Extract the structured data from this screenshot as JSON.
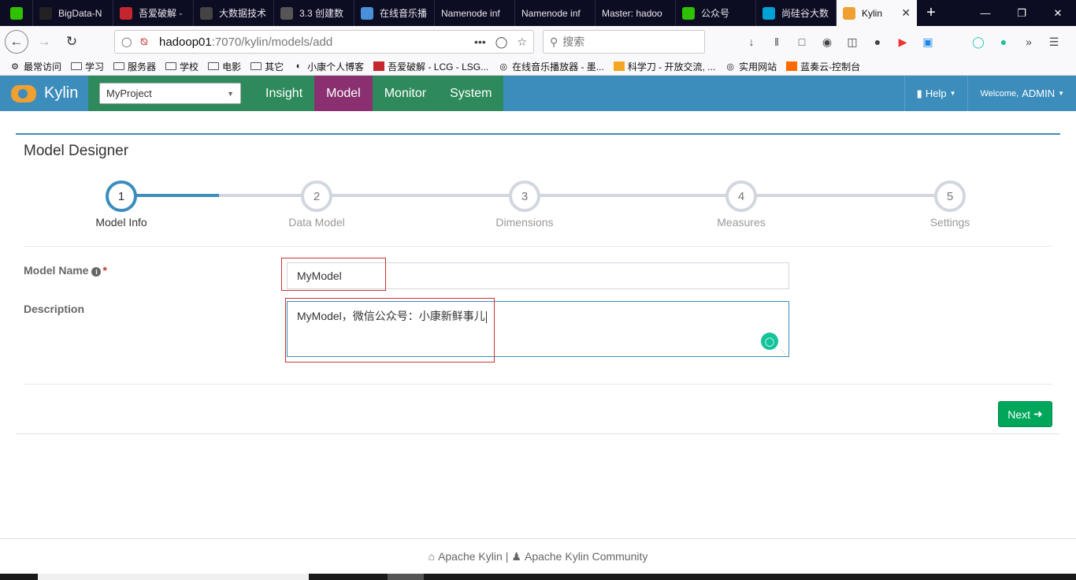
{
  "browser": {
    "tabs": [
      {
        "title": "",
        "icon": "wechat-icon",
        "color": "#2dc100"
      },
      {
        "title": "BigData-N",
        "icon": "dark-app-icon",
        "color": "#222"
      },
      {
        "title": "吾爱破解 -",
        "icon": "52pojie-icon",
        "color": "#c4262e"
      },
      {
        "title": "大数据技术",
        "icon": "bookmark-icon",
        "color": "#444"
      },
      {
        "title": "3.3 创建数",
        "icon": "book-icon",
        "color": "#555"
      },
      {
        "title": "在线音乐播",
        "icon": "globe-icon",
        "color": "#4a90d9"
      },
      {
        "title": "Namenode inf",
        "icon": "",
        "color": ""
      },
      {
        "title": "Namenode inf",
        "icon": "",
        "color": ""
      },
      {
        "title": "Master: hadoo",
        "icon": "",
        "color": ""
      },
      {
        "title": "公众号",
        "icon": "wechat-icon",
        "color": "#2dc100"
      },
      {
        "title": "尚硅谷大数",
        "icon": "bilibili-icon",
        "color": "#00a1d6"
      },
      {
        "title": "Kylin",
        "icon": "kylin-icon",
        "color": "#f0a030",
        "active": true
      }
    ],
    "url_host": "hadoop01",
    "url_rest": ":7070/kylin/models/add",
    "search_placeholder": "搜索",
    "bookmarks": [
      {
        "label": "最常访问",
        "icon": "gear-icon"
      },
      {
        "label": "学习",
        "icon": "folder-icon"
      },
      {
        "label": "服务器",
        "icon": "folder-icon"
      },
      {
        "label": "学校",
        "icon": "folder-icon"
      },
      {
        "label": "电影",
        "icon": "folder-icon"
      },
      {
        "label": "其它",
        "icon": "folder-icon"
      },
      {
        "label": "小康个人博客",
        "icon": "blog-icon"
      },
      {
        "label": "吾爱破解 - LCG - LSG...",
        "icon": "52pojie-icon"
      },
      {
        "label": "在线音乐播放器 - 墨...",
        "icon": "globe-icon"
      },
      {
        "label": "科学刀 - 开放交流, ...",
        "icon": "knife-icon"
      },
      {
        "label": "实用网站",
        "icon": "globe-icon"
      },
      {
        "label": "蓝奏云-控制台",
        "icon": "lanzou-icon"
      }
    ]
  },
  "kylin": {
    "brand": "Kylin",
    "project": "MyProject",
    "menu": [
      {
        "label": "Insight",
        "active": false
      },
      {
        "label": "Model",
        "active": true
      },
      {
        "label": "Monitor",
        "active": false
      },
      {
        "label": "System",
        "active": false
      }
    ],
    "help_label": "Help",
    "welcome_prefix": "Welcome,",
    "welcome_user": "ADMIN"
  },
  "designer": {
    "title": "Model Designer",
    "steps": [
      {
        "num": "1",
        "label": "Model Info",
        "active": true
      },
      {
        "num": "2",
        "label": "Data Model",
        "active": false
      },
      {
        "num": "3",
        "label": "Dimensions",
        "active": false
      },
      {
        "num": "4",
        "label": "Measures",
        "active": false
      },
      {
        "num": "5",
        "label": "Settings",
        "active": false
      }
    ],
    "model_name_label": "Model Name",
    "model_name_value": "MyModel",
    "description_label": "Description",
    "description_value": "MyModel，微信公众号：小康新鲜事儿",
    "next_label": "Next"
  },
  "footer": {
    "link1": "Apache Kylin",
    "separator": "|",
    "link2": "Apache Kylin Community"
  },
  "colors": {
    "header_blue": "#3c8dbc",
    "menu_green": "#2e8a5c",
    "menu_active": "#8a2f6f",
    "next_green": "#00a65a",
    "highlight_red": "#d32f2f"
  }
}
